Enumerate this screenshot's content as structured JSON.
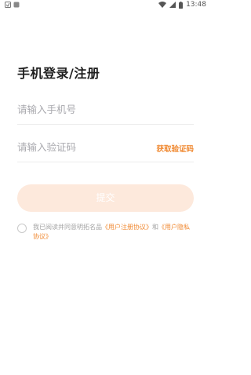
{
  "status_bar": {
    "time": "13:48",
    "icons": [
      "signal-icon",
      "wifi-icon",
      "battery-icon"
    ]
  },
  "title": "手机登录/注册",
  "phone_field": {
    "placeholder": "请输入手机号"
  },
  "code_field": {
    "placeholder": "请输入验证码",
    "get_code_label": "获取验证码"
  },
  "submit_label": "提交",
  "agreement": {
    "prefix": "我已阅读并同意明拓名品",
    "user_agreement": "《用户注册协议》",
    "conjunction": "和",
    "privacy_policy": "《用户隐私协议》"
  },
  "colors": {
    "accent": "#f08a33",
    "button_bg": "#fde9dc",
    "placeholder": "#a9a9ae",
    "muted_text": "#a3a3a3"
  }
}
